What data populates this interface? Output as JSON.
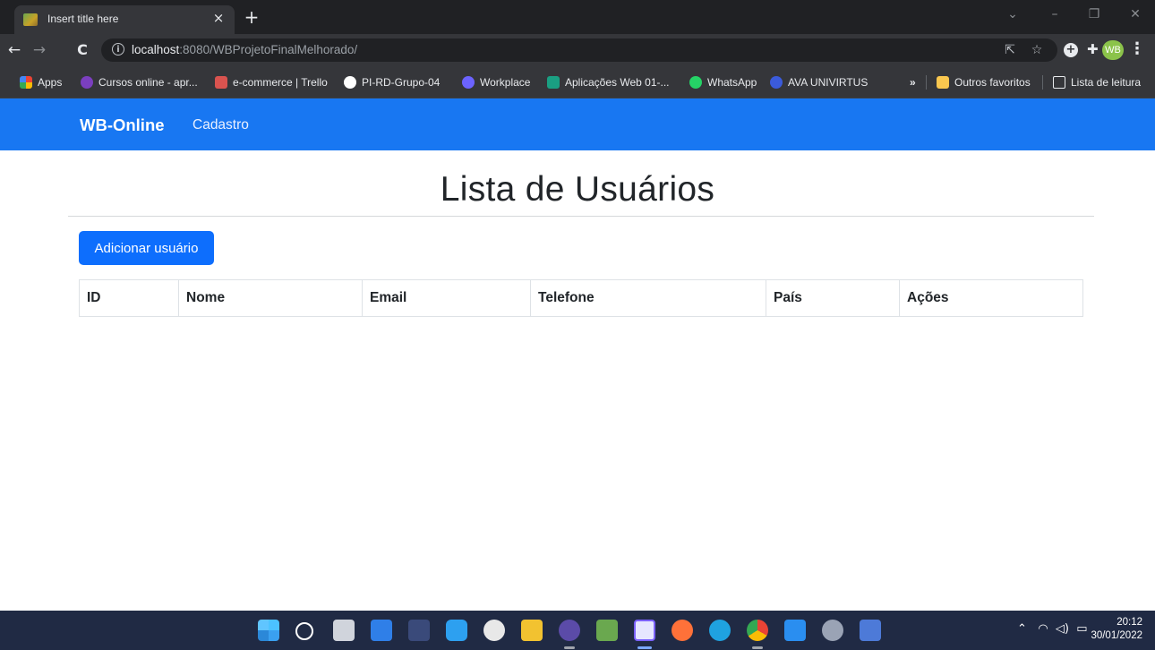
{
  "browser": {
    "tab_title": "Insert title here",
    "tab_close": "×",
    "new_tab": "+",
    "url_host": "localhost",
    "url_rest": ":8080/WBProjetoFinalMelhorado/",
    "profile_initials": "WB",
    "bookmarks": [
      {
        "label": "Apps",
        "icon": "apps-grid-icon",
        "color": "#ea4335"
      },
      {
        "label": "Cursos online - apr...",
        "icon": "cursos-icon",
        "color": "#7b3fbf"
      },
      {
        "label": "e-commerce | Trello",
        "icon": "trello-icon",
        "color": "#d9534f"
      },
      {
        "label": "PI-RD-Grupo-04",
        "icon": "github-icon",
        "color": "#ffffff"
      },
      {
        "label": "Workplace",
        "icon": "workplace-icon",
        "color": "#6c63ff"
      },
      {
        "label": "Aplicações Web 01-...",
        "icon": "classroom-icon",
        "color": "#1a9f82"
      },
      {
        "label": "WhatsApp",
        "icon": "whatsapp-icon",
        "color": "#25d366"
      },
      {
        "label": "AVA UNIVIRTUS",
        "icon": "univirtus-icon",
        "color": "#3b5bdb"
      }
    ],
    "bookmarks_overflow": "»",
    "other_favorites": "Outros favoritos",
    "reading_list": "Lista de leitura"
  },
  "page": {
    "brand": "WB-Online",
    "nav_link": "Cadastro",
    "title": "Lista de Usuários",
    "add_button": "Adicionar usuário",
    "table_headers": [
      "ID",
      "Nome",
      "Email",
      "Telefone",
      "País",
      "Ações"
    ]
  },
  "taskbar": {
    "time": "20:12",
    "date": "30/01/2022"
  }
}
